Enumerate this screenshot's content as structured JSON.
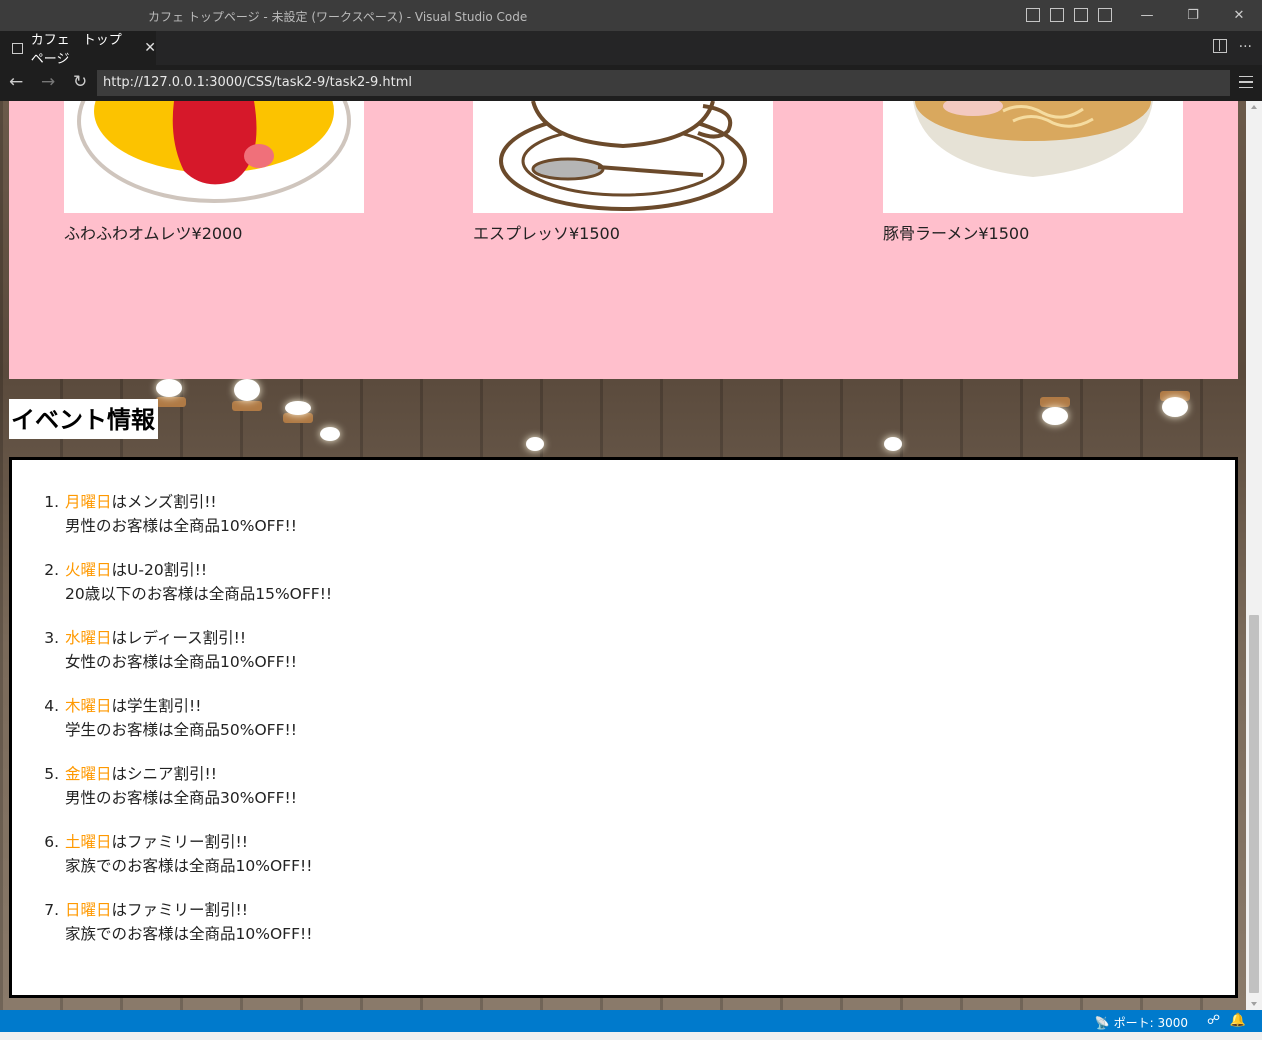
{
  "window": {
    "title": "カフェ トップページ - 未設定 (ワークスペース) - Visual Studio Code"
  },
  "tab": {
    "label": "カフェ　トップページ",
    "close": "✕"
  },
  "nav": {
    "back": "←",
    "forward": "→",
    "reload": "↻",
    "url": "http://127.0.0.1:3000/CSS/task2-9/task2-9.html"
  },
  "menu_items": [
    {
      "caption": "ふわふわオムレツ¥2000",
      "icon": "omelette-image"
    },
    {
      "caption": "エスプレッソ¥1500",
      "icon": "espresso-image"
    },
    {
      "caption": "豚骨ラーメン¥1500",
      "icon": "ramen-image"
    }
  ],
  "events": {
    "heading": "イベント情報",
    "items": [
      {
        "num": "1.",
        "day": "月曜日",
        "title": "はメンズ割引!!",
        "detail": "男性のお客様は全商品10%OFF!!"
      },
      {
        "num": "2.",
        "day": "火曜日",
        "title": "はU-20割引!!",
        "detail": "20歳以下のお客様は全商品15%OFF!!"
      },
      {
        "num": "3.",
        "day": "水曜日",
        "title": "はレディース割引!!",
        "detail": "女性のお客様は全商品10%OFF!!"
      },
      {
        "num": "4.",
        "day": "木曜日",
        "title": "は学生割引!!",
        "detail": "学生のお客様は全商品50%OFF!!"
      },
      {
        "num": "5.",
        "day": "金曜日",
        "title": "はシニア割引!!",
        "detail": "男性のお客様は全商品30%OFF!!"
      },
      {
        "num": "6.",
        "day": "土曜日",
        "title": "はファミリー割引!!",
        "detail": "家族でのお客様は全商品10%OFF!!"
      },
      {
        "num": "7.",
        "day": "日曜日",
        "title": "はファミリー割引!!",
        "detail": "家族でのお客様は全商品10%OFF!!"
      }
    ]
  },
  "statusbar": {
    "port": "ポート: 3000"
  },
  "colors": {
    "menu_panel": "#ffbfcc",
    "day_highlight": "#ff9900",
    "statusbar": "#007acc"
  }
}
